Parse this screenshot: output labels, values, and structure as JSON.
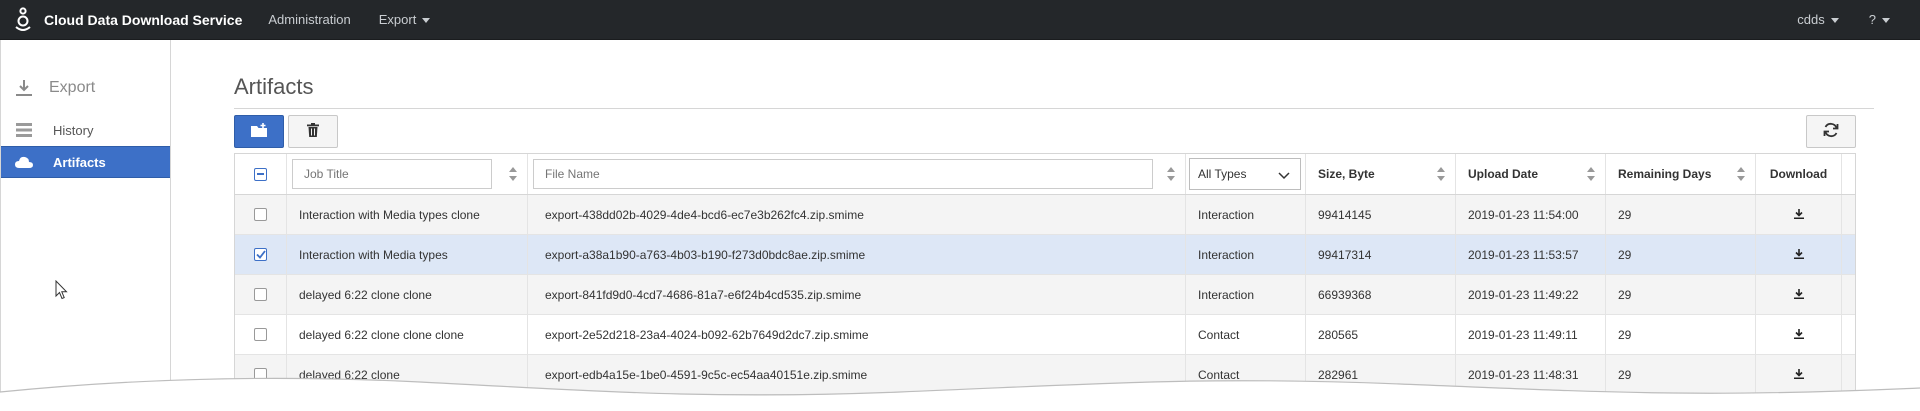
{
  "app": {
    "title": "Cloud Data Download Service",
    "nav": [
      {
        "label": "Administration",
        "has_dropdown": false
      },
      {
        "label": "Export",
        "has_dropdown": true
      }
    ],
    "user_menu": "cdds",
    "help_menu": "?"
  },
  "sidebar": {
    "header": "Export",
    "items": [
      {
        "label": "History",
        "icon": "list-icon",
        "active": false
      },
      {
        "label": "Artifacts",
        "icon": "cloud-icon",
        "active": true
      }
    ]
  },
  "page": {
    "title": "Artifacts"
  },
  "toolbar": {
    "add_icon": "folder-add-icon",
    "delete_icon": "trash-icon",
    "refresh_icon": "refresh-icon"
  },
  "table": {
    "filters": {
      "job_title_placeholder": "Job Title",
      "file_name_placeholder": "File Name",
      "type_selected": "All Types"
    },
    "columns": {
      "size": "Size, Byte",
      "upload_date": "Upload Date",
      "remaining_days": "Remaining Days",
      "download": "Download"
    },
    "rows": [
      {
        "job": "Interaction with Media types clone",
        "file": "export-438dd02b-4029-4de4-bcd6-ec7e3b262fc4.zip.smime",
        "type": "Interaction",
        "size": "99414145",
        "date": "2019-01-23 11:54:00",
        "days": "29",
        "checked": false
      },
      {
        "job": "Interaction with Media types",
        "file": "export-a38a1b90-a763-4b03-b190-f273d0bdc8ae.zip.smime",
        "type": "Interaction",
        "size": "99417314",
        "date": "2019-01-23 11:53:57",
        "days": "29",
        "checked": true
      },
      {
        "job": "delayed 6:22 clone clone",
        "file": "export-841fd9d0-4cd7-4686-81a7-e6f24b4cd535.zip.smime",
        "type": "Interaction",
        "size": "66939368",
        "date": "2019-01-23 11:49:22",
        "days": "29",
        "checked": false
      },
      {
        "job": "delayed 6:22 clone clone clone",
        "file": "export-2e52d218-23a4-4024-b092-62b7649d2dc7.zip.smime",
        "type": "Contact",
        "size": "280565",
        "date": "2019-01-23 11:49:11",
        "days": "29",
        "checked": false
      },
      {
        "job": "delayed 6:22 clone",
        "file": "export-edb4a15e-1be0-4591-9c5c-ec54aa40151e.zip.smime",
        "type": "Contact",
        "size": "282961",
        "date": "2019-01-23 11:48:31",
        "days": "29",
        "checked": false
      }
    ]
  },
  "colors": {
    "navbar": "#24272a",
    "accent": "#3d70c7",
    "selected_row": "#dde7f6"
  }
}
